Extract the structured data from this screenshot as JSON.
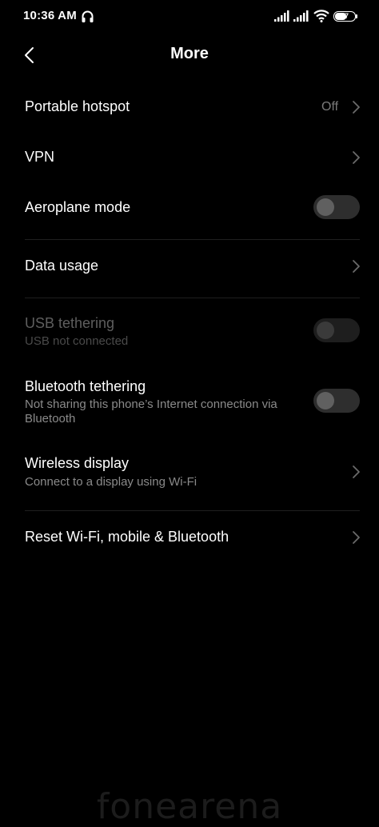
{
  "status_bar": {
    "time": "10:36 AM",
    "battery": "57"
  },
  "header": {
    "title": "More"
  },
  "items": [
    {
      "title": "Portable hotspot",
      "value": "Off"
    },
    {
      "title": "VPN"
    },
    {
      "title": "Aeroplane mode"
    },
    {
      "title": "Data usage"
    },
    {
      "title": "USB tethering",
      "subtitle": "USB not connected"
    },
    {
      "title": "Bluetooth tethering",
      "subtitle": "Not sharing this phone’s Internet connection via Bluetooth"
    },
    {
      "title": "Wireless display",
      "subtitle": "Connect to a display using Wi-Fi"
    },
    {
      "title": "Reset Wi-Fi, mobile & Bluetooth"
    }
  ],
  "watermark": "fonearena"
}
